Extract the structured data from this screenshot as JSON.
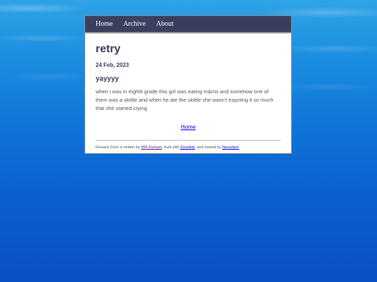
{
  "nav": {
    "items": [
      "Home",
      "Archive",
      "About"
    ]
  },
  "post": {
    "title": "retry",
    "date": "24 Feb, 2023",
    "subtitle": "yayyyy",
    "body": "when i was in eighth grade this girl was eating m&ms and somehow one of them was a skittle and when he ate the skittle she wasn't expcting it so much that she started crying"
  },
  "home_link": "Home",
  "footer": {
    "prefix": "Reward Zone is written by ",
    "author": "Will Durham",
    "mid": ", built with ",
    "tool": "Zonelets",
    "mid2": ", and hosted by ",
    "host": "Neocities!"
  },
  "colors": {
    "nav_bg": "#3b3f5e",
    "heading": "#3a3f5c",
    "link": "#0000ee",
    "visited_link": "#551a8b"
  }
}
